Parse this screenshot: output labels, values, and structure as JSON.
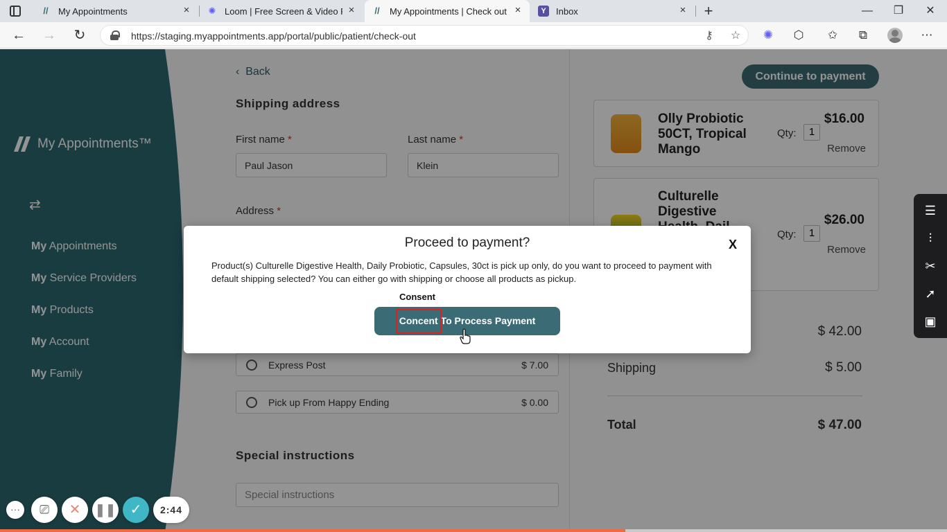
{
  "browser": {
    "tabs": [
      {
        "title": "My Appointments",
        "active": false
      },
      {
        "title": "Loom | Free Screen & Video Rec",
        "active": false
      },
      {
        "title": "My Appointments | Check out",
        "active": true
      },
      {
        "title": "Inbox",
        "active": false
      }
    ],
    "url": "https://staging.myappointments.app/portal/public/patient/check-out"
  },
  "sidebar": {
    "brand_name": "My Appointments™",
    "nav": [
      {
        "prefix": "My",
        "label": " Appointments"
      },
      {
        "prefix": "My",
        "label": " Service Providers"
      },
      {
        "prefix": "My",
        "label": " Products"
      },
      {
        "prefix": "My",
        "label": " Account"
      },
      {
        "prefix": "My",
        "label": " Family"
      }
    ]
  },
  "form": {
    "back_label": "Back",
    "shipping_heading": "Shipping address",
    "first_name_label": "First name",
    "last_name_label": "Last name",
    "required_mark": "*",
    "first_name_value": "Paul Jason",
    "last_name_value": "Klein",
    "address_label": "Address",
    "shipping_options": [
      {
        "label": "Express Post",
        "price": "$ 7.00"
      },
      {
        "label": "Pick up From Happy Ending",
        "price": "$ 0.00"
      }
    ],
    "special_heading": "Special instructions",
    "special_placeholder": "Special instructions"
  },
  "cart": {
    "continue_label": "Continue to payment",
    "items": [
      {
        "name": "Olly Probiotic 50CT, Tropical Mango",
        "qty_label": "Qty:",
        "qty": "1",
        "price": "$16.00",
        "remove": "Remove"
      },
      {
        "name": "Culturelle Digestive Health, Dail",
        "qty_label": "Qty:",
        "qty": "1",
        "price": "$26.00",
        "remove": "Remove"
      }
    ],
    "subtotal_value": "$ 42.00",
    "shipping_label": "Shipping",
    "shipping_value": "$ 5.00",
    "total_label": "Total",
    "total_value": "$ 47.00"
  },
  "modal": {
    "title": "Proceed to payment?",
    "close": "X",
    "body": "Product(s) Culturelle Digestive Health, Daily Probiotic, Capsules, 30ct is pick up only, do you want to proceed to payment with default shipping selected? You can either go with shipping or choose all products as pickup.",
    "consent_label": "Consent",
    "button_label": "Concent To Process Payment"
  },
  "recorder": {
    "timer": "2:44",
    "progress": 0.66
  },
  "colors": {
    "teal": "#3b6b74",
    "sidebar_teal": "#2c6870",
    "highlight_red": "#e02020",
    "progress_orange": "#ef6b45"
  }
}
